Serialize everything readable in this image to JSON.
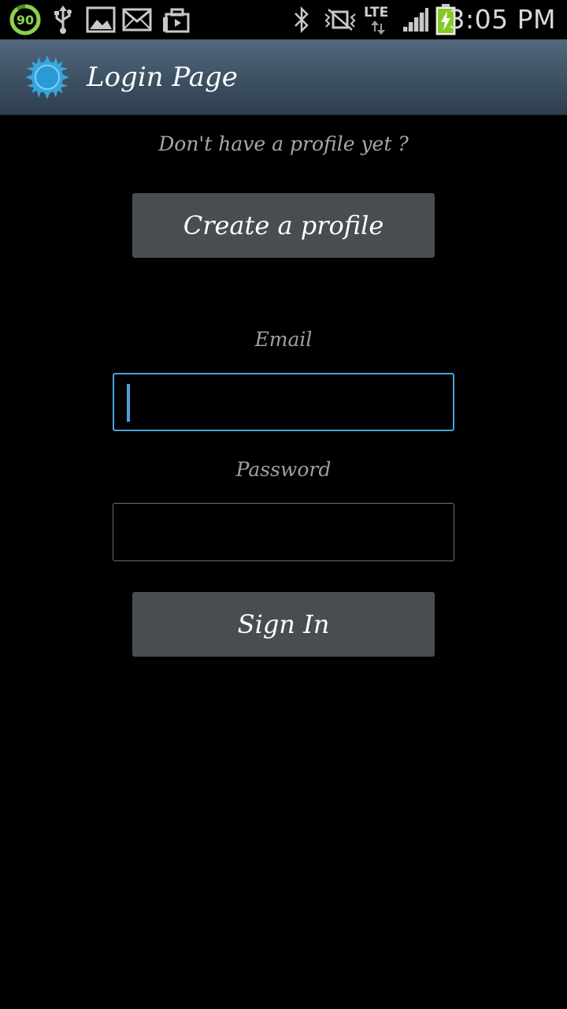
{
  "status_bar": {
    "battery_ring_value": "90",
    "network": "LTE",
    "time": "3:05 PM",
    "icons": [
      "battery-ring-icon",
      "usb-icon",
      "image-icon",
      "mail-icon",
      "briefcase-icon",
      "bluetooth-icon",
      "vibrate-icon",
      "lte-icon",
      "signal-icon",
      "battery-charging-icon"
    ]
  },
  "header": {
    "title": "Login Page",
    "icon": "sun-icon"
  },
  "login": {
    "prompt": "Don't have a profile yet ?",
    "create_profile_label": "Create a profile",
    "email_label": "Email",
    "email_value": "",
    "password_label": "Password",
    "password_value": "",
    "sign_in_label": "Sign In"
  },
  "colors": {
    "background": "#000000",
    "action_bar": "#3d5163",
    "button": "#4a4d50",
    "accent": "#4aa3d8"
  }
}
